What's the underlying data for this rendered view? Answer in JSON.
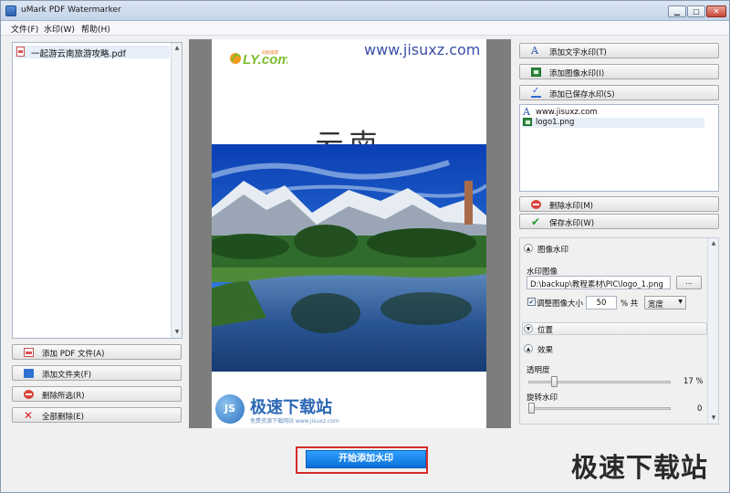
{
  "window": {
    "title": "uMark PDF Watermarker",
    "controls": {
      "minimize": "▁",
      "maximize": "□",
      "close": "✕"
    }
  },
  "menu": [
    "文件(F)",
    "水印(W)",
    "帮助(H)"
  ],
  "left_panel": {
    "files": [
      {
        "name": "一起游云南旅游攻略.pdf",
        "icon": "pdf-file-icon"
      }
    ],
    "buttons": {
      "add_pdf": "添加 PDF 文件(A)",
      "add_folder": "添加文件夹(F)",
      "remove_selected": "删除所选(R)",
      "remove_all": "全部删除(E)"
    }
  },
  "preview": {
    "watermark_text": "www.jisuxz.com",
    "logo_text": "LY.com",
    "logo_small": "同程旅游",
    "page_title": "云南",
    "logo_watermark_name": "极速下载站",
    "logo_watermark_sub": "免费资源下载网站  www.jisuxz.com",
    "logo_watermark_badge": "JS"
  },
  "right_panel": {
    "buttons": {
      "add_text": "添加文字水印(T)",
      "add_image": "添加图像水印(I)",
      "add_saved": "添加已保存水印(S)",
      "delete": "删除水印(M)",
      "save": "保存水印(W)"
    },
    "watermarks": [
      {
        "name": "www.jisuxz.com",
        "type": "text"
      },
      {
        "name": "logo1.png",
        "type": "image"
      }
    ],
    "image_section": {
      "title": "图像水印",
      "image_label": "水印图像",
      "image_path": "D:\\backup\\教程素材\\PIC\\logo_1.png",
      "browse": "...",
      "resize_label": "调整图像大小",
      "resize_checked": true,
      "resize_value": "50",
      "percent_of": "% 共",
      "resize_mode": "宽度"
    },
    "position_section": {
      "title": "位置"
    },
    "effect_section": {
      "title": "效果",
      "opacity_label": "透明度",
      "opacity_value": "17 %",
      "opacity_fraction": 0.17,
      "rotation_label": "旋转水印",
      "rotation_value": "0",
      "rotation_fraction": 0
    }
  },
  "start_button": "开始添加水印",
  "corner_brand": "极速下载站"
}
